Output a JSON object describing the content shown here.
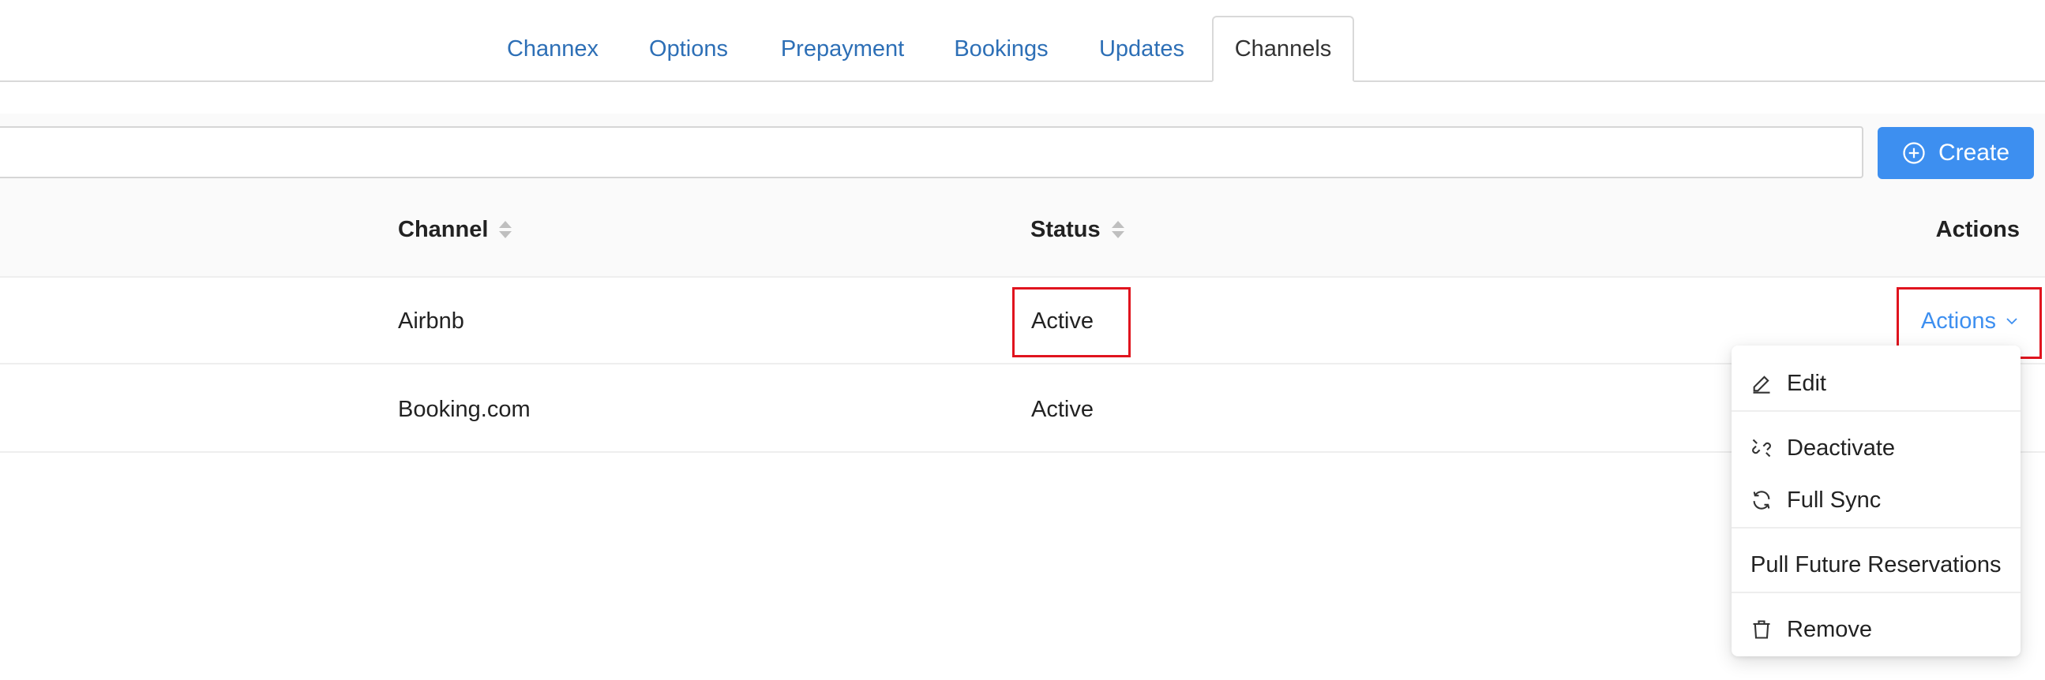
{
  "tabs": [
    {
      "label": "Channex",
      "active": false
    },
    {
      "label": "Options",
      "active": false
    },
    {
      "label": "Prepayment",
      "active": false
    },
    {
      "label": "Bookings",
      "active": false
    },
    {
      "label": "Updates",
      "active": false
    },
    {
      "label": "Channels",
      "active": true
    }
  ],
  "toolbar": {
    "search_value": "",
    "search_placeholder": "",
    "create_label": "Create"
  },
  "table": {
    "columns": [
      {
        "label": "Channel",
        "sortable": true
      },
      {
        "label": "Status",
        "sortable": true
      },
      {
        "label": "Actions",
        "sortable": false
      }
    ],
    "rows": [
      {
        "channel": "Airbnb",
        "status": "Active",
        "actions_label": "Actions"
      },
      {
        "channel": "Booking.com",
        "status": "Active",
        "actions_label": ""
      }
    ]
  },
  "dropdown": {
    "items": [
      {
        "label": "Edit",
        "icon": "edit-icon"
      },
      {
        "label": "Deactivate",
        "icon": "unlink-icon"
      },
      {
        "label": "Full Sync",
        "icon": "sync-icon"
      },
      {
        "label": "Pull Future Reservations",
        "icon": ""
      },
      {
        "label": "Remove",
        "icon": "trash-icon"
      }
    ]
  },
  "colors": {
    "link": "#2d6fb6",
    "primary": "#3d8ff0",
    "highlight": "#e0141e"
  }
}
